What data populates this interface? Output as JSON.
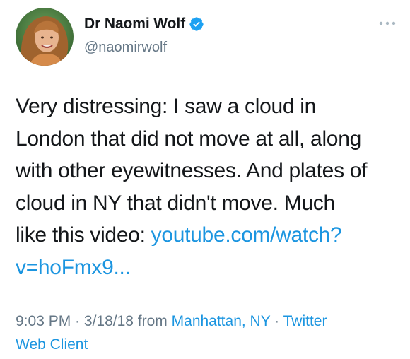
{
  "tweet": {
    "author": {
      "display_name": "Dr Naomi Wolf",
      "handle": "@naomirwolf",
      "verified": true,
      "avatar_icon": "profile-photo"
    },
    "more_icon": "ellipsis-icon",
    "text_lines": [
      "Very distressing: I saw a cloud in",
      "London that did not move at all, along",
      "with other eyewitnesses. And plates of",
      "cloud in NY that didn't move. Much",
      "like this video: "
    ],
    "link": {
      "line1": "youtube.com/watch?",
      "line2": "v=hoFmx9..."
    },
    "meta": {
      "time": "9:03 PM",
      "separator": " · ",
      "date": "3/18/18",
      "from": " from ",
      "location": "Manhattan, NY",
      "separator2": " · ",
      "client_line1": "Twitter",
      "client_line2": "Web Client"
    }
  },
  "colors": {
    "link": "#1b95e0",
    "muted": "#657786",
    "text": "#14171a",
    "verified": "#1da1f2"
  }
}
